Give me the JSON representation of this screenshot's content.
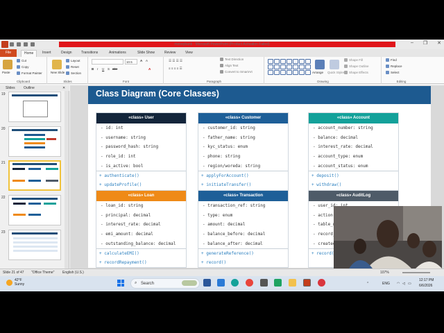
{
  "window": {
    "title": "moneybank  -  Microsoft PowerPoint (Product Activation Failed)"
  },
  "ribbon_tabs": [
    "File",
    "Home",
    "Insert",
    "Design",
    "Transitions",
    "Animations",
    "Slide Show",
    "Review",
    "View"
  ],
  "ribbon": {
    "clipboard": {
      "label": "Clipboard",
      "paste": "Paste",
      "cut": "Cut",
      "copy": "Copy",
      "format_painter": "Format Painter"
    },
    "slides": {
      "label": "Slides",
      "new_slide": "New Slide",
      "layout": "Layout",
      "reset": "Reset",
      "section": "Section"
    },
    "font": {
      "label": "Font",
      "size": "10.5"
    },
    "paragraph": {
      "label": "Paragraph",
      "text_direction": "Text Direction",
      "align_text": "Align Text",
      "convert_smartart": "Convert to SmartArt"
    },
    "drawing": {
      "label": "Drawing",
      "arrange": "Arrange",
      "quick_styles": "Quick Styles",
      "shape_fill": "Shape Fill",
      "shape_outline": "Shape Outline",
      "shape_effects": "Shape Effects"
    },
    "editing": {
      "label": "Editing",
      "find": "Find",
      "replace": "Replace",
      "select": "Select"
    }
  },
  "panel_tabs": {
    "slides": "Slides",
    "outline": "Outline"
  },
  "thumbnails": [
    {
      "num": "19"
    },
    {
      "num": "20"
    },
    {
      "num": "21"
    },
    {
      "num": "22"
    },
    {
      "num": "23"
    }
  ],
  "slide": {
    "title": "Class Diagram (Core Classes)",
    "classes": [
      {
        "header": "«class» User",
        "color": "#13253b",
        "attrs": [
          "- id: int",
          "- username: string",
          "- password_hash: string",
          "- role_id: int",
          "- is_active: bool"
        ],
        "methods": [
          "+ authenticate()",
          "+ updateProfile()"
        ]
      },
      {
        "header": "«class» Customer",
        "color": "#1e5f98",
        "attrs": [
          "- customer_id: string",
          "- father_name: string",
          "- kyc_status: enum",
          "- phone: string",
          "- region/woreda: string"
        ],
        "methods": [
          "+ applyForAccount()",
          "+ initiateTransfer()"
        ]
      },
      {
        "header": "«class» Account",
        "color": "#13a19a",
        "attrs": [
          "- account_number: string",
          "- balance: decimal",
          "- interest_rate: decimal",
          "- account_type: enum",
          "- account_status: enum"
        ],
        "methods": [
          "+ deposit()",
          "+ withdraw()"
        ]
      },
      {
        "header": "«class» Loan",
        "color": "#ef8a17",
        "attrs": [
          "- loan_id: string",
          "- principal: decimal",
          "- interest_rate: decimal",
          "- emi_amount: decimal",
          "- outstanding_balance: decimal"
        ],
        "methods": [
          "+ calculateEMI()",
          "+ recordRepayment()"
        ]
      },
      {
        "header": "«class» Transaction",
        "color": "#1e5f98",
        "attrs": [
          "- transaction_ref: string",
          "- type: enum",
          "- amount: decimal",
          "- balance_before: decimal",
          "- balance_after: decimal"
        ],
        "methods": [
          "+ generateReference()",
          "+ record()"
        ]
      },
      {
        "header": "«class» AuditLog",
        "color": "#4e5b68",
        "attrs": [
          "- user_id: int",
          "- action:",
          "- table_n",
          "- record_i",
          "- created_"
        ],
        "methods": [
          "+ record("
        ]
      }
    ]
  },
  "statusbar": {
    "slide_info": "Slide 21 of 47",
    "theme": "\"Office Theme\"",
    "language": "English (U.S.)",
    "zoom": "107%"
  },
  "taskbar": {
    "weather_temp": "42°F",
    "weather_desc": "Sunny",
    "search_placeholder": "Search",
    "lang": "ENG",
    "time": "12:17 PM",
    "date": "6/6/2026"
  }
}
